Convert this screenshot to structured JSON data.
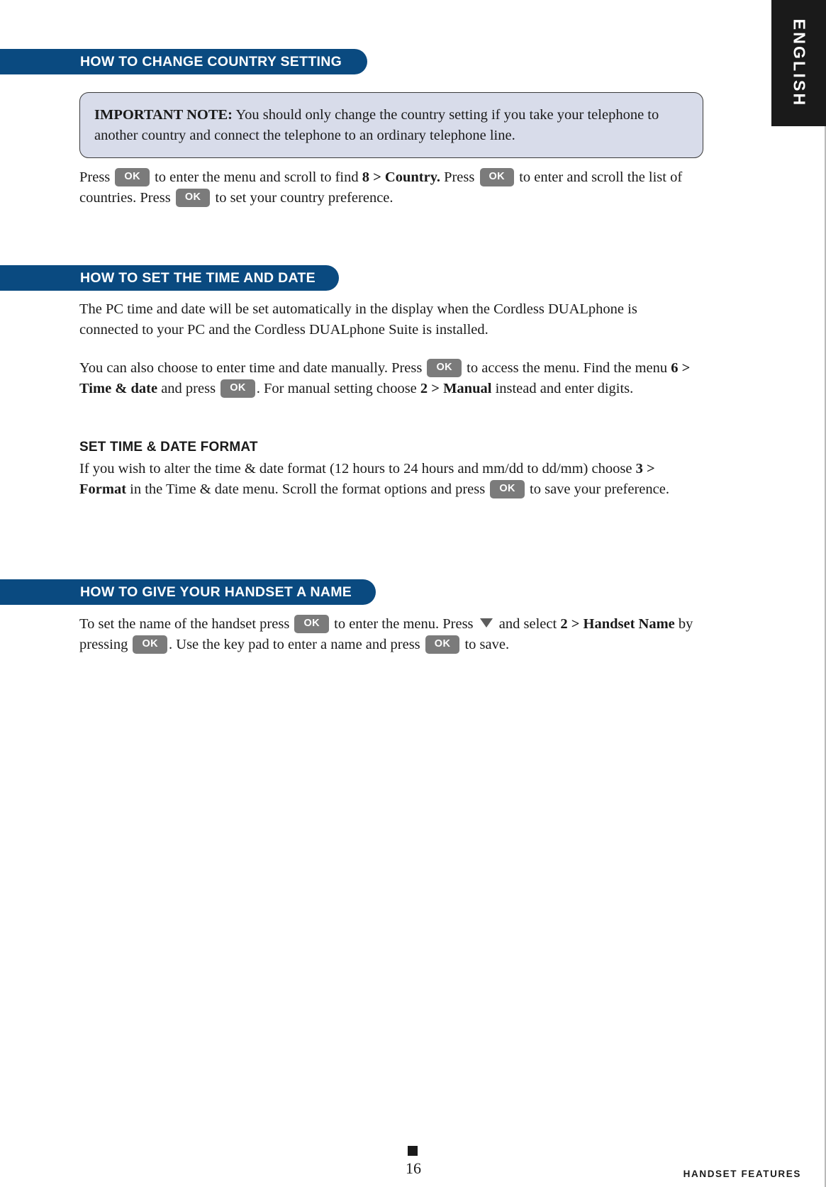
{
  "language_tab": {
    "label": "ENGLISH"
  },
  "sections": [
    {
      "banner": "HOW TO CHANGE COUNTRY SETTING",
      "note": {
        "label": "IMPORTANT NOTE:",
        "text": " You should only change the country setting if you take your telephone to another country and connect the telephone to an ordinary telephone line."
      },
      "paragraph": {
        "p1_a": "Press ",
        "p1_b": " to enter the menu and scroll to find ",
        "menu_1": "8 > Country.",
        "p1_c": " Press ",
        "p1_d": " to enter and scroll the list of countries. Press ",
        "p1_e": " to set your country preference."
      }
    },
    {
      "banner": "HOW TO SET THE TIME AND DATE",
      "paragraph_1": "The PC time and date will be set automatically in the display when the Cordless DUALphone is connected to your PC and the Cordless DUALphone Suite is installed.",
      "paragraph_2": {
        "p2_a": "You can also choose to enter time and date manually. Press ",
        "p2_b": " to access the menu. Find the menu ",
        "menu_1": "6 > Time & date",
        "p2_c": " and press ",
        "p2_d": ". For manual setting choose ",
        "menu_2": "2 > Manual",
        "p2_e": " instead and enter digits."
      },
      "subheading": "SET TIME & DATE FORMAT",
      "paragraph_3": {
        "p3_a": "If you wish to alter the time & date format (12 hours to 24 hours and mm/dd to dd/mm) choose ",
        "menu_1": "3 > Format",
        "p3_b": " in the Time & date menu. Scroll the format options and press ",
        "p3_c": " to save your preference."
      }
    },
    {
      "banner": "HOW TO GIVE YOUR HANDSET A NAME",
      "paragraph": {
        "p4_a": "To set the name of the handset press ",
        "p4_b": " to enter the menu. Press ",
        "p4_c": " and select ",
        "menu_1": "2 > Handset Name",
        "p4_d": " by pressing ",
        "p4_e": ". Use the key pad to enter a name and press ",
        "p4_f": " to save."
      }
    }
  ],
  "keys": {
    "ok_label": "OK",
    "down_arrow": "down-arrow"
  },
  "footer": {
    "page_number": "16",
    "section_name": "HANDSET FEATURES"
  },
  "colors": {
    "banner_blue": "#0a4a80",
    "note_fill": "#d8dcea",
    "key_grey": "#7b7b7b",
    "tab_black": "#1a1a1a"
  }
}
